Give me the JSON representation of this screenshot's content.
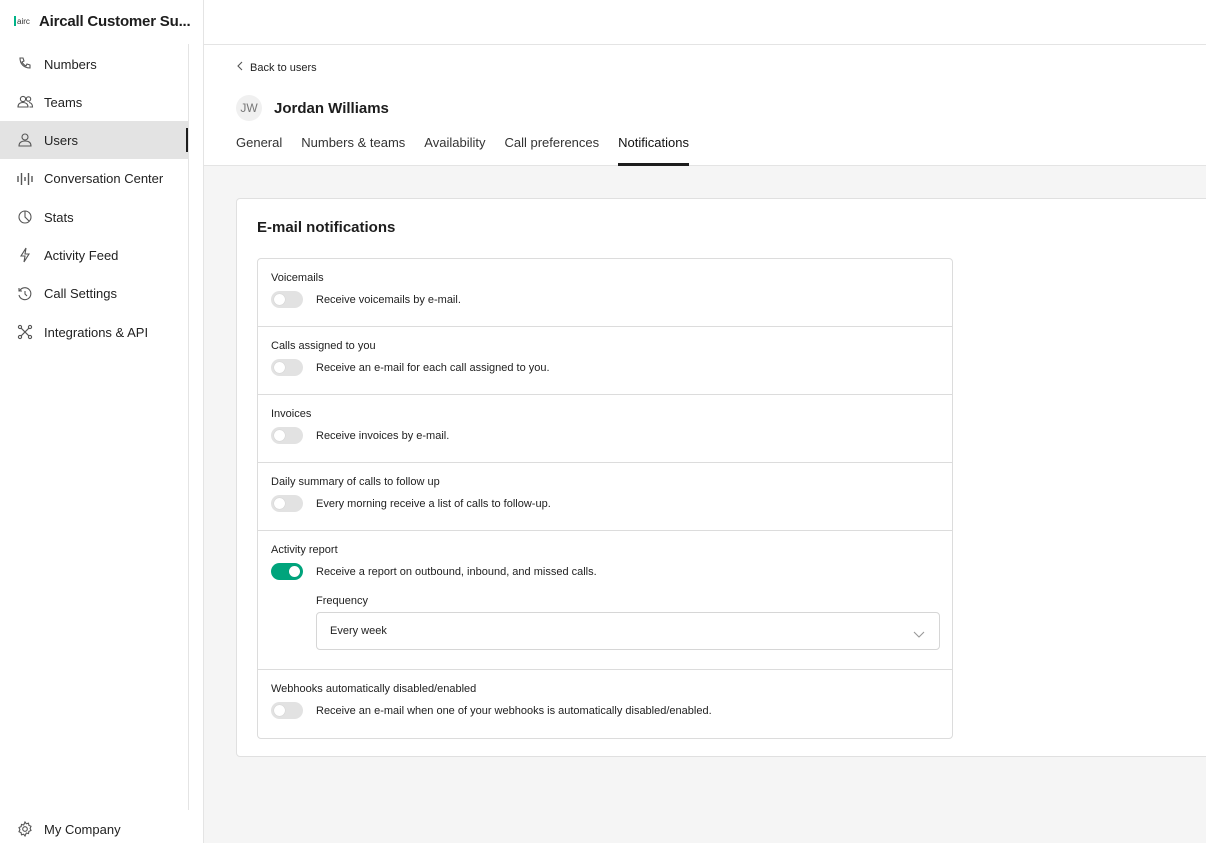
{
  "brand": {
    "title": "Aircall Customer Su...",
    "logo_text": "airc"
  },
  "sidebar": {
    "items": [
      {
        "label": "Numbers",
        "icon": "phone-icon"
      },
      {
        "label": "Teams",
        "icon": "team-icon"
      },
      {
        "label": "Users",
        "icon": "user-icon",
        "active": true
      },
      {
        "label": "Conversation Center",
        "icon": "waveform-icon"
      },
      {
        "label": "Stats",
        "icon": "pie-chart-icon"
      },
      {
        "label": "Activity Feed",
        "icon": "lightning-icon"
      },
      {
        "label": "Call Settings",
        "icon": "history-icon"
      },
      {
        "label": "Integrations & API",
        "icon": "integrations-icon"
      }
    ],
    "bottom": {
      "label": "My Company",
      "icon": "gear-icon"
    }
  },
  "header": {
    "back_label": "Back to users",
    "avatar_initials": "JW",
    "user_name": "Jordan Williams",
    "tabs": [
      "General",
      "Numbers & teams",
      "Availability",
      "Call preferences",
      "Notifications"
    ],
    "active_tab": "Notifications"
  },
  "card": {
    "title": "E-mail notifications",
    "rows": [
      {
        "title": "Voicemails",
        "desc": "Receive voicemails by e-mail.",
        "enabled": false
      },
      {
        "title": "Calls assigned to you",
        "desc": "Receive an e-mail for each call assigned to you.",
        "enabled": false
      },
      {
        "title": "Invoices",
        "desc": "Receive invoices by e-mail.",
        "enabled": false
      },
      {
        "title": "Daily summary of calls to follow up",
        "desc": "Every morning receive a list of calls to follow-up.",
        "enabled": false
      },
      {
        "title": "Activity report",
        "desc": "Receive a report on outbound, inbound, and missed calls.",
        "enabled": true
      },
      {
        "title": "Webhooks automatically disabled/enabled",
        "desc": "Receive an e-mail when one of your webhooks is automatically disabled/enabled.",
        "enabled": false
      }
    ],
    "frequency_label": "Frequency",
    "frequency_value": "Every week"
  },
  "colors": {
    "accent": "#00a47c",
    "active_nav_bg": "#e3e3e3"
  }
}
